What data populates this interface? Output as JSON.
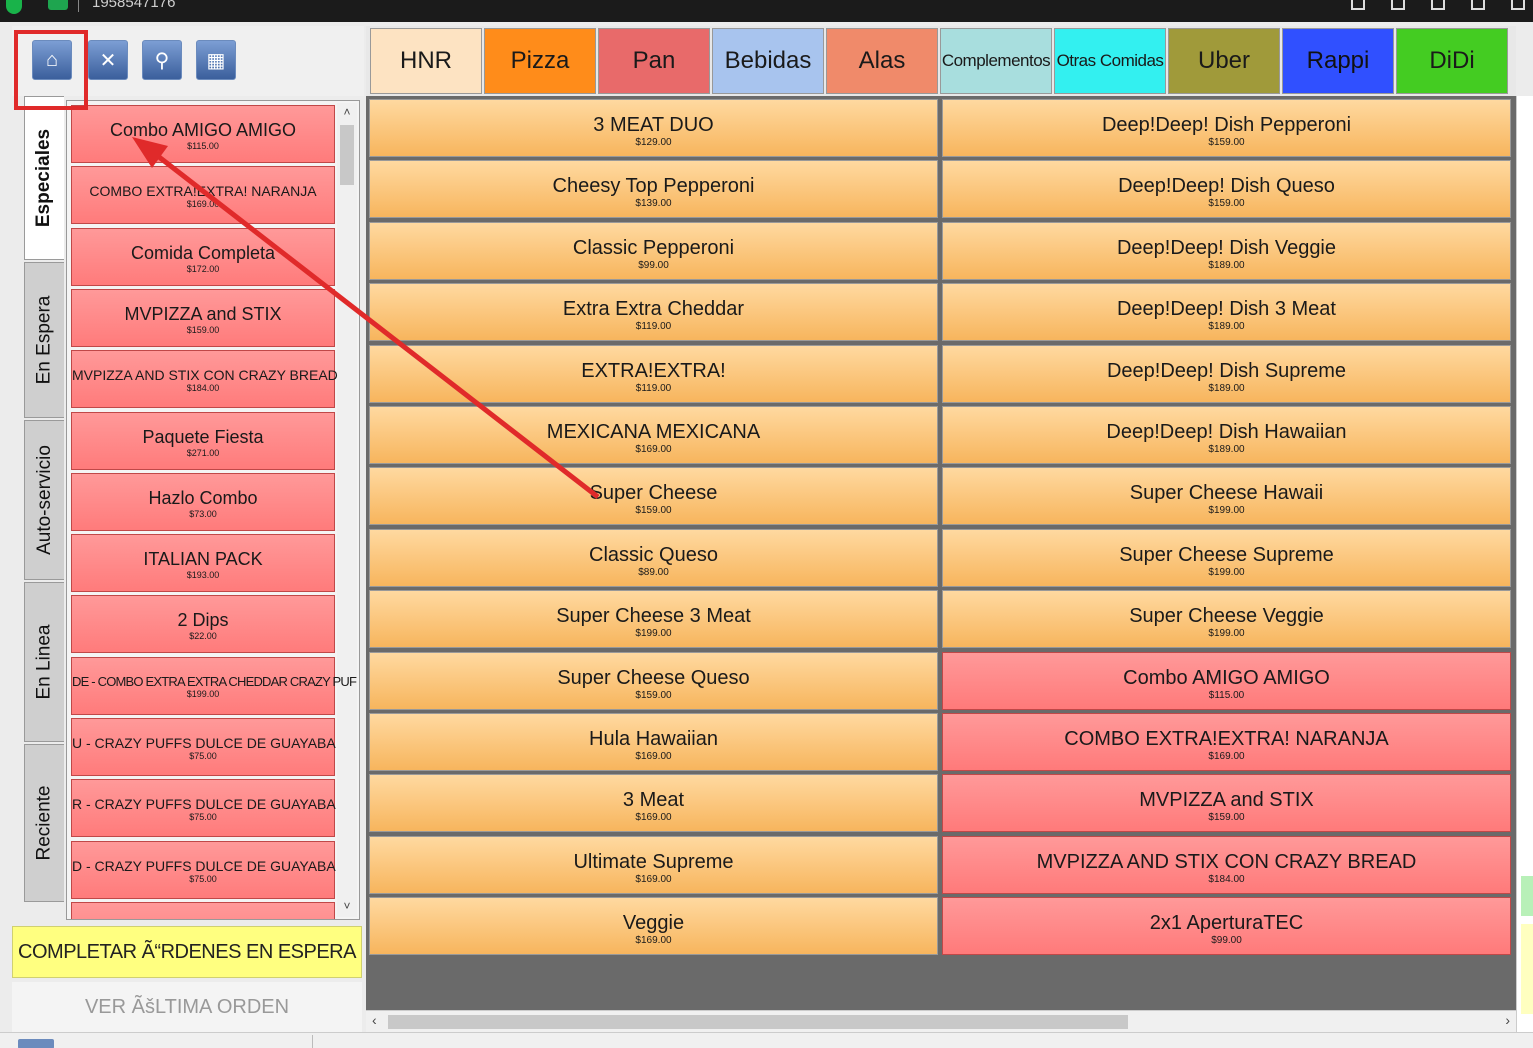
{
  "window": {
    "title": "1958547176"
  },
  "toolbar": {
    "buttons": [
      {
        "name": "home-icon",
        "glyph": "⌂"
      },
      {
        "name": "tools-icon",
        "glyph": "✕"
      },
      {
        "name": "search-icon",
        "glyph": "⚲"
      },
      {
        "name": "calculator-icon",
        "glyph": "▦"
      }
    ]
  },
  "categories": [
    {
      "label": "HNR",
      "color": "#fde3c2"
    },
    {
      "label": "Pizza",
      "color": "#ff8c1a"
    },
    {
      "label": "Pan",
      "color": "#e86a6a"
    },
    {
      "label": "Bebidas",
      "color": "#a8c4ee"
    },
    {
      "label": "Alas",
      "color": "#f08a6a"
    },
    {
      "label": "Complementos",
      "color": "#a8dede"
    },
    {
      "label": "Otras Comidas",
      "color": "#33f0f0"
    },
    {
      "label": "Uber",
      "color": "#a09a3a"
    },
    {
      "label": "Rappi",
      "color": "#3050ff"
    },
    {
      "label": "DiDi",
      "color": "#44cc22"
    }
  ],
  "side_tabs": [
    "Especiales",
    "En Espera",
    "Auto-servicio",
    "En Linea",
    "Reciente"
  ],
  "specials": [
    {
      "name": "Combo AMIGO AMIGO",
      "price": "$115.00"
    },
    {
      "name": "COMBO EXTRA!EXTRA! NARANJA",
      "price": "$169.00"
    },
    {
      "name": "Comida Completa",
      "price": "$172.00"
    },
    {
      "name": "MVPIZZA and STIX",
      "price": "$159.00"
    },
    {
      "name": "MVPIZZA AND STIX CON CRAZY BREAD",
      "price": "$184.00"
    },
    {
      "name": "Paquete Fiesta",
      "price": "$271.00"
    },
    {
      "name": "Hazlo Combo",
      "price": "$73.00"
    },
    {
      "name": "ITALIAN PACK",
      "price": "$193.00"
    },
    {
      "name": "2 Dips",
      "price": "$22.00"
    },
    {
      "name": "DE - COMBO EXTRA EXTRA CHEDDAR CRAZY PUF",
      "price": "$199.00"
    },
    {
      "name": "U - CRAZY PUFFS DULCE DE GUAYABA",
      "price": "$75.00"
    },
    {
      "name": "R - CRAZY PUFFS DULCE DE GUAYABA",
      "price": "$75.00"
    },
    {
      "name": "D - CRAZY PUFFS DULCE DE GUAYABA",
      "price": "$75.00"
    }
  ],
  "products_left": [
    {
      "name": "3 MEAT DUO",
      "price": "$129.00"
    },
    {
      "name": "Cheesy Top Pepperoni",
      "price": "$139.00"
    },
    {
      "name": "Classic Pepperoni",
      "price": "$99.00"
    },
    {
      "name": "Extra Extra Cheddar",
      "price": "$119.00"
    },
    {
      "name": "EXTRA!EXTRA!",
      "price": "$119.00"
    },
    {
      "name": "MEXICANA MEXICANA",
      "price": "$169.00"
    },
    {
      "name": "Super Cheese",
      "price": "$159.00"
    },
    {
      "name": "Classic Queso",
      "price": "$89.00"
    },
    {
      "name": "Super Cheese 3 Meat",
      "price": "$199.00"
    },
    {
      "name": "Super Cheese Queso",
      "price": "$159.00"
    },
    {
      "name": "Hula Hawaiian",
      "price": "$169.00"
    },
    {
      "name": "3 Meat",
      "price": "$169.00"
    },
    {
      "name": "Ultimate Supreme",
      "price": "$169.00"
    },
    {
      "name": "Veggie",
      "price": "$169.00"
    }
  ],
  "products_right": [
    {
      "name": "Deep!Deep! Dish Pepperoni",
      "price": "$159.00",
      "style": "orange"
    },
    {
      "name": "Deep!Deep! Dish Queso",
      "price": "$159.00",
      "style": "orange"
    },
    {
      "name": "Deep!Deep! Dish Veggie",
      "price": "$189.00",
      "style": "orange"
    },
    {
      "name": "Deep!Deep! Dish 3 Meat",
      "price": "$189.00",
      "style": "orange"
    },
    {
      "name": "Deep!Deep! Dish Supreme",
      "price": "$189.00",
      "style": "orange"
    },
    {
      "name": "Deep!Deep! Dish Hawaiian",
      "price": "$189.00",
      "style": "orange"
    },
    {
      "name": "Super Cheese Hawaii",
      "price": "$199.00",
      "style": "orange"
    },
    {
      "name": "Super Cheese Supreme",
      "price": "$199.00",
      "style": "orange"
    },
    {
      "name": "Super Cheese Veggie",
      "price": "$199.00",
      "style": "orange"
    },
    {
      "name": "Combo AMIGO AMIGO",
      "price": "$115.00",
      "style": "red"
    },
    {
      "name": "COMBO EXTRA!EXTRA! NARANJA",
      "price": "$169.00",
      "style": "red"
    },
    {
      "name": "MVPIZZA and STIX",
      "price": "$159.00",
      "style": "red"
    },
    {
      "name": "MVPIZZA AND STIX CON CRAZY BREAD",
      "price": "$184.00",
      "style": "red"
    },
    {
      "name": "2x1 AperturaTEC",
      "price": "$99.00",
      "style": "red"
    }
  ],
  "actions": {
    "complete_label": "COMPLETAR Ã“RDENES EN ESPERA",
    "last_order_label": "VER ÃšLTIMA ORDEN"
  },
  "annotation_color": "#e02a2a"
}
